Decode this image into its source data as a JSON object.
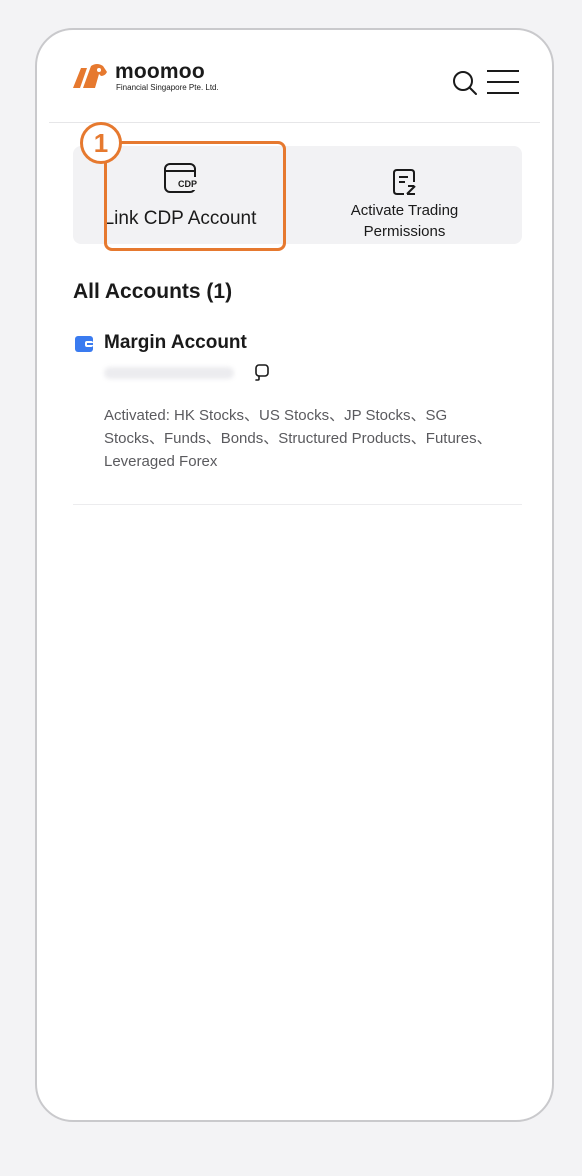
{
  "brand": {
    "name": "moomoo",
    "subtitle": "Financial Singapore Pte. Ltd.",
    "color": "#e6792f"
  },
  "header": {
    "icons": [
      "search-icon",
      "menu-icon"
    ]
  },
  "actions": {
    "link_cdp": {
      "label": "Link CDP Account",
      "icon": "cdp-icon",
      "icon_text": "CDP"
    },
    "activate_trading": {
      "label": "Activate Trading Permissions",
      "icon": "document-edit-icon"
    }
  },
  "annotation": {
    "step_number": "1",
    "highlight_color": "#e6792f"
  },
  "accounts": {
    "title": "All Accounts (1)",
    "items": [
      {
        "name": "Margin Account",
        "icon": "wallet-icon",
        "icon_color": "#3a7bf0",
        "number_hidden": true,
        "markets": "Activated: HK Stocks、US Stocks、JP Stocks、SG Stocks、Funds、Bonds、Structured Products、Futures、Leveraged Forex"
      }
    ]
  }
}
